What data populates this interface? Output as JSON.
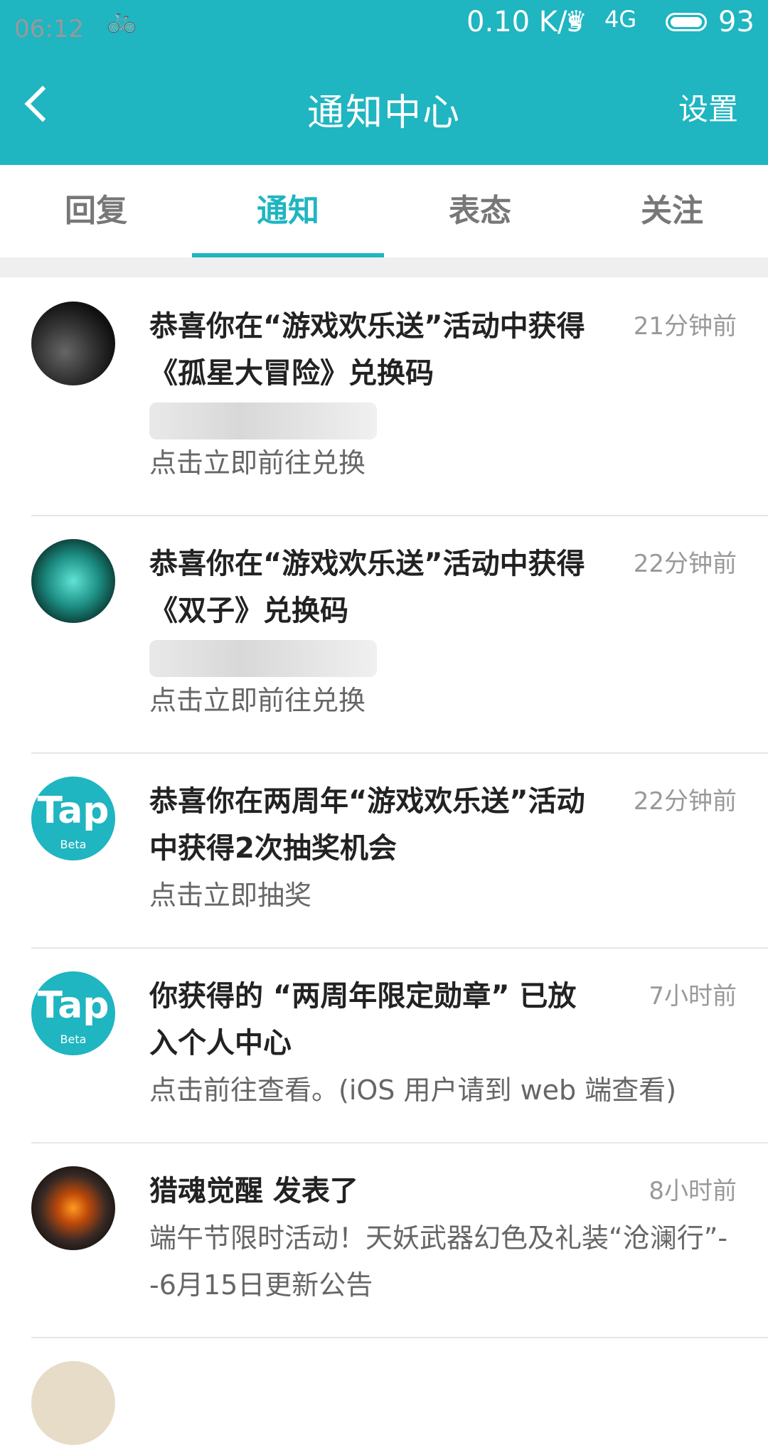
{
  "status_bar": {
    "time": "06:12",
    "bike_icon": "🚲",
    "network_speed": "0.10 K/s",
    "crown_icon": "♛",
    "signal": "4G",
    "battery_percent": "93"
  },
  "navbar": {
    "back_label": "",
    "title": "通知中心",
    "settings_label": "设置"
  },
  "tabs": [
    {
      "label": "回复",
      "active": false
    },
    {
      "label": "通知",
      "active": true
    },
    {
      "label": "表态",
      "active": false
    },
    {
      "label": "关注",
      "active": false
    }
  ],
  "notifications": [
    {
      "title": "恭喜你在“游戏欢乐送”活动中获得《孤星大冒险》兑换码",
      "time": "21分钟前",
      "subtitle": "点击立即前往兑换",
      "avatar": "dark"
    },
    {
      "title": "恭喜你在“游戏欢乐送”活动中获得《双子》兑换码",
      "time": "22分钟前",
      "subtitle": "点击立即前往兑换",
      "avatar": "teal"
    },
    {
      "title": "恭喜你在两周年“游戏欢乐送”活动中获得2次抽奖机会",
      "time": "22分钟前",
      "subtitle": "点击立即抽奖",
      "avatar": "tap",
      "avatar_text": "Tap",
      "avatar_sub": "Beta"
    },
    {
      "title": "你获得的 “两周年限定勋章” 已放入个人中心",
      "time": "7小时前",
      "subtitle": "点击前往查看。(iOS 用户请到 web 端查看)",
      "avatar": "tap",
      "avatar_text": "Tap",
      "avatar_sub": "Beta"
    },
    {
      "title": "猎魂觉醒 发表了",
      "time": "8小时前",
      "subtitle": "端午节限时活动！天妖武器幻色及礼装“沧澜行”--6月15日更新公告",
      "avatar": "dragon"
    }
  ]
}
